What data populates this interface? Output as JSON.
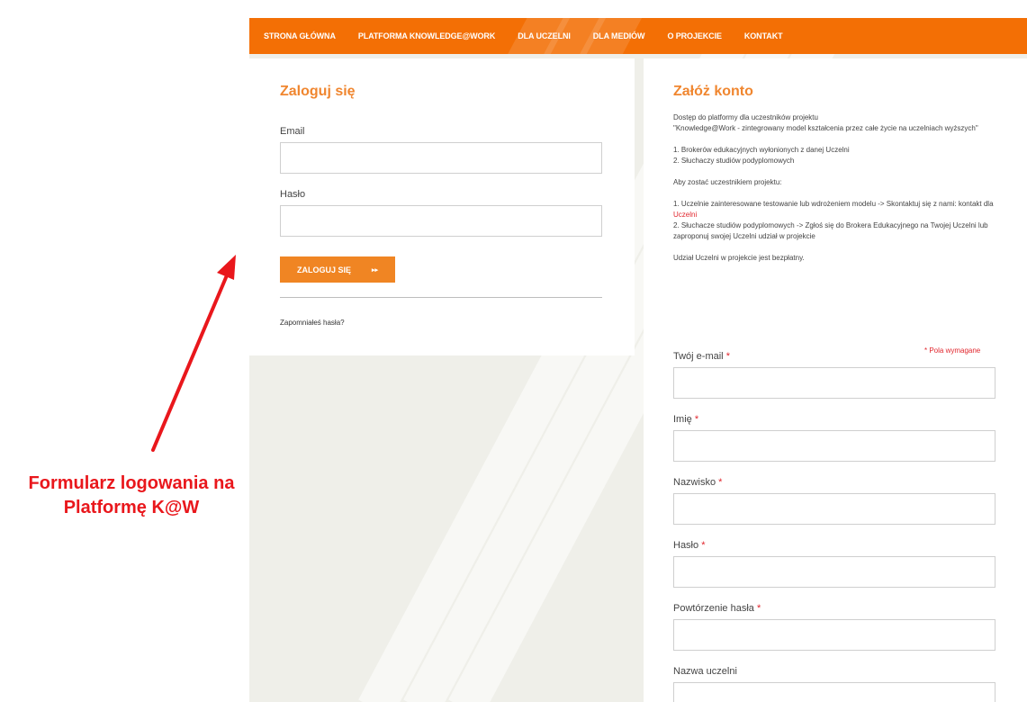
{
  "nav": {
    "items": [
      {
        "label": "STRONA GŁÓWNA"
      },
      {
        "label": "PLATFORMA KNOWLEDGE@WORK"
      },
      {
        "label": "DLA UCZELNI"
      },
      {
        "label": "DLA MEDIÓW"
      },
      {
        "label": "O PROJEKCIE"
      },
      {
        "label": "KONTAKT"
      }
    ]
  },
  "login": {
    "title": "Zaloguj się",
    "email_label": "Email",
    "email_value": "",
    "password_label": "Hasło",
    "password_value": "",
    "submit_label": "ZALOGUJ SIĘ",
    "submit_arrow": "▸▸",
    "forgot_link": "Zapomniałeś hasła?"
  },
  "register": {
    "title": "Załóż konto",
    "intro_line1": "Dostęp do platformy dla uczestników projektu",
    "intro_line2": "\"Knowledge@Work - zintegrowany model kształcenia przez całe życie na uczelniach wyższych\"",
    "list1_item1": "1. Brokerów edukacyjnych wyłonionych z danej Uczelni",
    "list1_item2": "2. Słuchaczy studiów podyplomowych",
    "how_to": "Aby zostać uczestnikiem projektu:",
    "step1_text": "1. Uczelnie zainteresowane testowanie lub wdrożeniem modelu -> Skontaktuj się z nami: kontakt dla ",
    "step1_link": "Uczelni",
    "step2_text": "2. Słuchacze studiów podyplomowych -> Zgłoś się do Brokera Edukacyjnego na Twojej Uczelni lub zaproponuj swojej Uczelni udział w projekcie",
    "free_note": "Udział Uczelni w projekcie jest bezpłatny.",
    "required_note": "* Pola wymagane",
    "required_star": "*",
    "fields": [
      {
        "label": "Twój e-mail",
        "value": ""
      },
      {
        "label": "Imię",
        "value": ""
      },
      {
        "label": "Nazwisko",
        "value": ""
      },
      {
        "label": "Hasło",
        "value": ""
      },
      {
        "label": "Powtórzenie hasła",
        "value": ""
      },
      {
        "label": "Nazwa uczelni",
        "value": ""
      }
    ]
  },
  "annotation": {
    "line1": "Formularz logowania na",
    "line2": "Platformę K@W",
    "color": "#e9171c"
  },
  "colors": {
    "brand_orange": "#f36f05",
    "button_orange": "#f08523",
    "title_orange": "#f0862f",
    "required_red": "#e1262d"
  }
}
